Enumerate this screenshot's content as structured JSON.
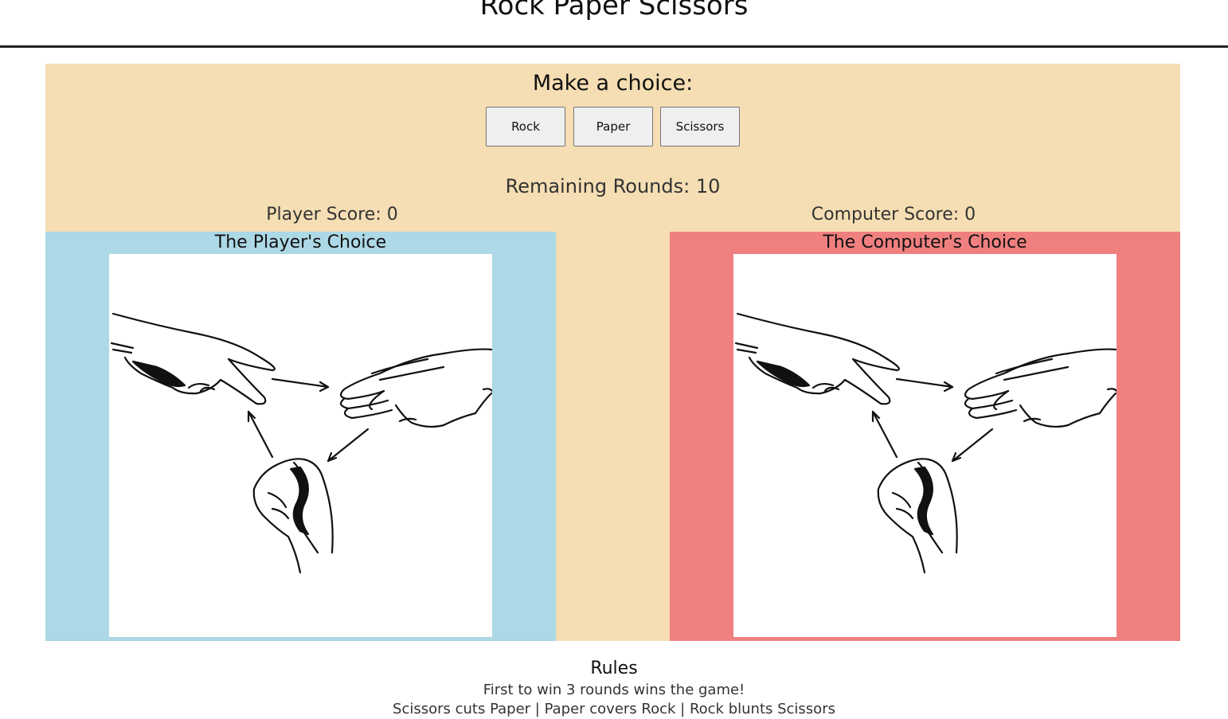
{
  "header": {
    "title": "Rock Paper Scissors"
  },
  "game": {
    "prompt": "Make a choice:",
    "buttons": {
      "rock": "Rock",
      "paper": "Paper",
      "scissors": "Scissors"
    },
    "remaining_rounds": "Remaining Rounds: 10",
    "player_score": "Player Score: 0",
    "computer_score": "Computer Score: 0"
  },
  "cards": {
    "player_title": "The Player's Choice",
    "computer_title": "The Computer's Choice"
  },
  "rules": {
    "title": "Rules",
    "line1": "First to win 3 rounds wins the game!",
    "line2": "Scissors cuts Paper | Paper covers Rock | Rock blunts Scissors"
  },
  "colors": {
    "panel": "#f5deb3",
    "player_card": "#add8e6",
    "computer_card": "#f08080"
  }
}
